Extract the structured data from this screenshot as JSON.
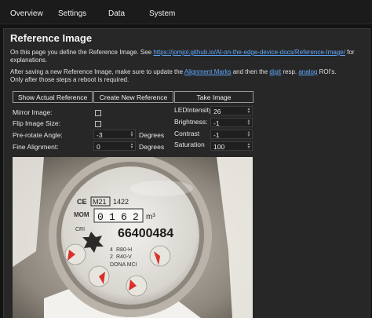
{
  "nav": [
    "Overview",
    "Settings",
    "Data",
    "System"
  ],
  "page_title": "Reference Image",
  "intro": {
    "text1": "On this page you define the Reference Image. See ",
    "link": "https://jomjol.github.io/AI-on-the-edge-device-docs/Reference-Image/",
    "text2": " for explanations."
  },
  "note": {
    "t1": "After saving a new Reference Image, make sure to update the ",
    "link1": "Alignment Marks",
    "t2": " and then the ",
    "link2": "digit",
    "t3": " resp. ",
    "link3": "analog",
    "t4": " ROI's.",
    "line2": "Only after those steps a reboot is required."
  },
  "buttons": {
    "show_actual": "Show Actual Reference",
    "create_new": "Create New Reference",
    "take_image": "Take Image"
  },
  "left_form": {
    "mirror_label": "Mirror Image:",
    "mirror_checked": false,
    "flip_label": "Flip Image Size:",
    "flip_checked": false,
    "prerotate_label": "Pre-rotate Angle:",
    "prerotate_value": "-3",
    "prerotate_unit": "Degrees",
    "fine_label": "Fine Alignment:",
    "fine_value": "0",
    "fine_unit": "Degrees"
  },
  "right_form": {
    "led_label": "LEDIntensity:",
    "led_value": "26",
    "brightness_label": "Brightness:",
    "brightness_value": "-1",
    "contrast_label": "Contrast",
    "contrast_value": "-1",
    "saturation_label": "Saturation",
    "saturation_value": "100"
  },
  "meter_image": {
    "brand": "MOM",
    "model": "M21",
    "year": "1422",
    "counter": [
      "0",
      "1",
      "6",
      "2"
    ],
    "serial": "66400484",
    "class_text": "CRI",
    "unit": "m³",
    "marking1": "R80-H",
    "marking2": "R40-V",
    "marking3": "DONA MCI",
    "marking4": "2",
    "marking5": "4"
  }
}
